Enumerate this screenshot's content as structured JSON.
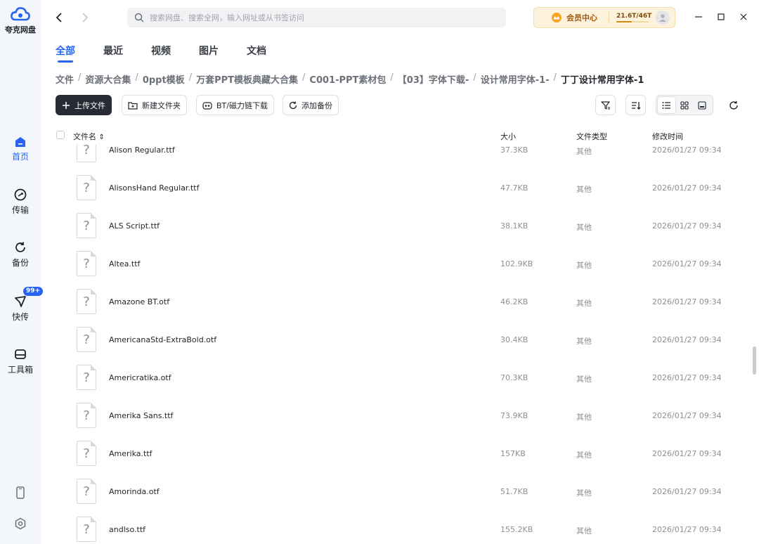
{
  "app": {
    "logo_text": "夸克网盘",
    "brand_color": "#2864f0"
  },
  "sidebar": {
    "items": [
      {
        "label": "首页",
        "icon": "home-icon",
        "active": true
      },
      {
        "label": "传输",
        "icon": "transfer-icon"
      },
      {
        "label": "备份",
        "icon": "backup-icon"
      },
      {
        "label": "快传",
        "icon": "quick-send-icon",
        "badge": "99+"
      },
      {
        "label": "工具箱",
        "icon": "toolbox-icon"
      }
    ],
    "bottom_icons": [
      "phone-icon",
      "settings-icon"
    ]
  },
  "search": {
    "placeholder": "搜索网盘、搜索全网，输入网址或从书签访问"
  },
  "member": {
    "label": "会员中心",
    "storage": "21.6T/46T",
    "storage_used_fraction": 0.47
  },
  "tabs": [
    {
      "label": "全部",
      "active": true
    },
    {
      "label": "最近"
    },
    {
      "label": "视频"
    },
    {
      "label": "图片"
    },
    {
      "label": "文档"
    }
  ],
  "breadcrumb": [
    "文件",
    "资源大合集",
    "0ppt模板",
    "万套PPT模板典藏大合集",
    "C001-PPT素材包",
    "【03】字体下载-",
    "设计常用字体-1-",
    "丁丁设计常用字体-1"
  ],
  "breadcrumb_sep": "/",
  "toolbar": {
    "upload": "上传文件",
    "new_folder": "新建文件夹",
    "bt_download": "BT/磁力链下载",
    "add_backup": "添加备份"
  },
  "columns": {
    "name": "文件名",
    "sort_indicator": "⇕",
    "size": "大小",
    "type": "文件类型",
    "modified": "修改时间"
  },
  "files": [
    {
      "icon": "?",
      "name": "Alison Regular.ttf",
      "size": "37.3KB",
      "type": "其他",
      "modified": "2026/01/27 09:34"
    },
    {
      "icon": "?",
      "name": "AlisonsHand Regular.ttf",
      "size": "47.7KB",
      "type": "其他",
      "modified": "2026/01/27 09:34"
    },
    {
      "icon": "?",
      "name": "ALS Script.ttf",
      "size": "38.1KB",
      "type": "其他",
      "modified": "2026/01/27 09:34"
    },
    {
      "icon": "?",
      "name": "Altea.ttf",
      "size": "102.9KB",
      "type": "其他",
      "modified": "2026/01/27 09:34"
    },
    {
      "icon": "?",
      "name": "Amazone BT.otf",
      "size": "46.2KB",
      "type": "其他",
      "modified": "2026/01/27 09:34"
    },
    {
      "icon": "?",
      "name": "AmericanaStd-ExtraBold.otf",
      "size": "30.4KB",
      "type": "其他",
      "modified": "2026/01/27 09:34"
    },
    {
      "icon": "?",
      "name": "Americratika.otf",
      "size": "70.3KB",
      "type": "其他",
      "modified": "2026/01/27 09:34"
    },
    {
      "icon": "?",
      "name": "Amerika Sans.ttf",
      "size": "73.9KB",
      "type": "其他",
      "modified": "2026/01/27 09:34"
    },
    {
      "icon": "?",
      "name": "Amerika.ttf",
      "size": "157KB",
      "type": "其他",
      "modified": "2026/01/27 09:34"
    },
    {
      "icon": "?",
      "name": "Amorinda.otf",
      "size": "51.7KB",
      "type": "其他",
      "modified": "2026/01/27 09:34"
    },
    {
      "icon": "?",
      "name": "andlso.ttf",
      "size": "155.2KB",
      "type": "其他",
      "modified": "2026/01/27 09:34"
    }
  ]
}
